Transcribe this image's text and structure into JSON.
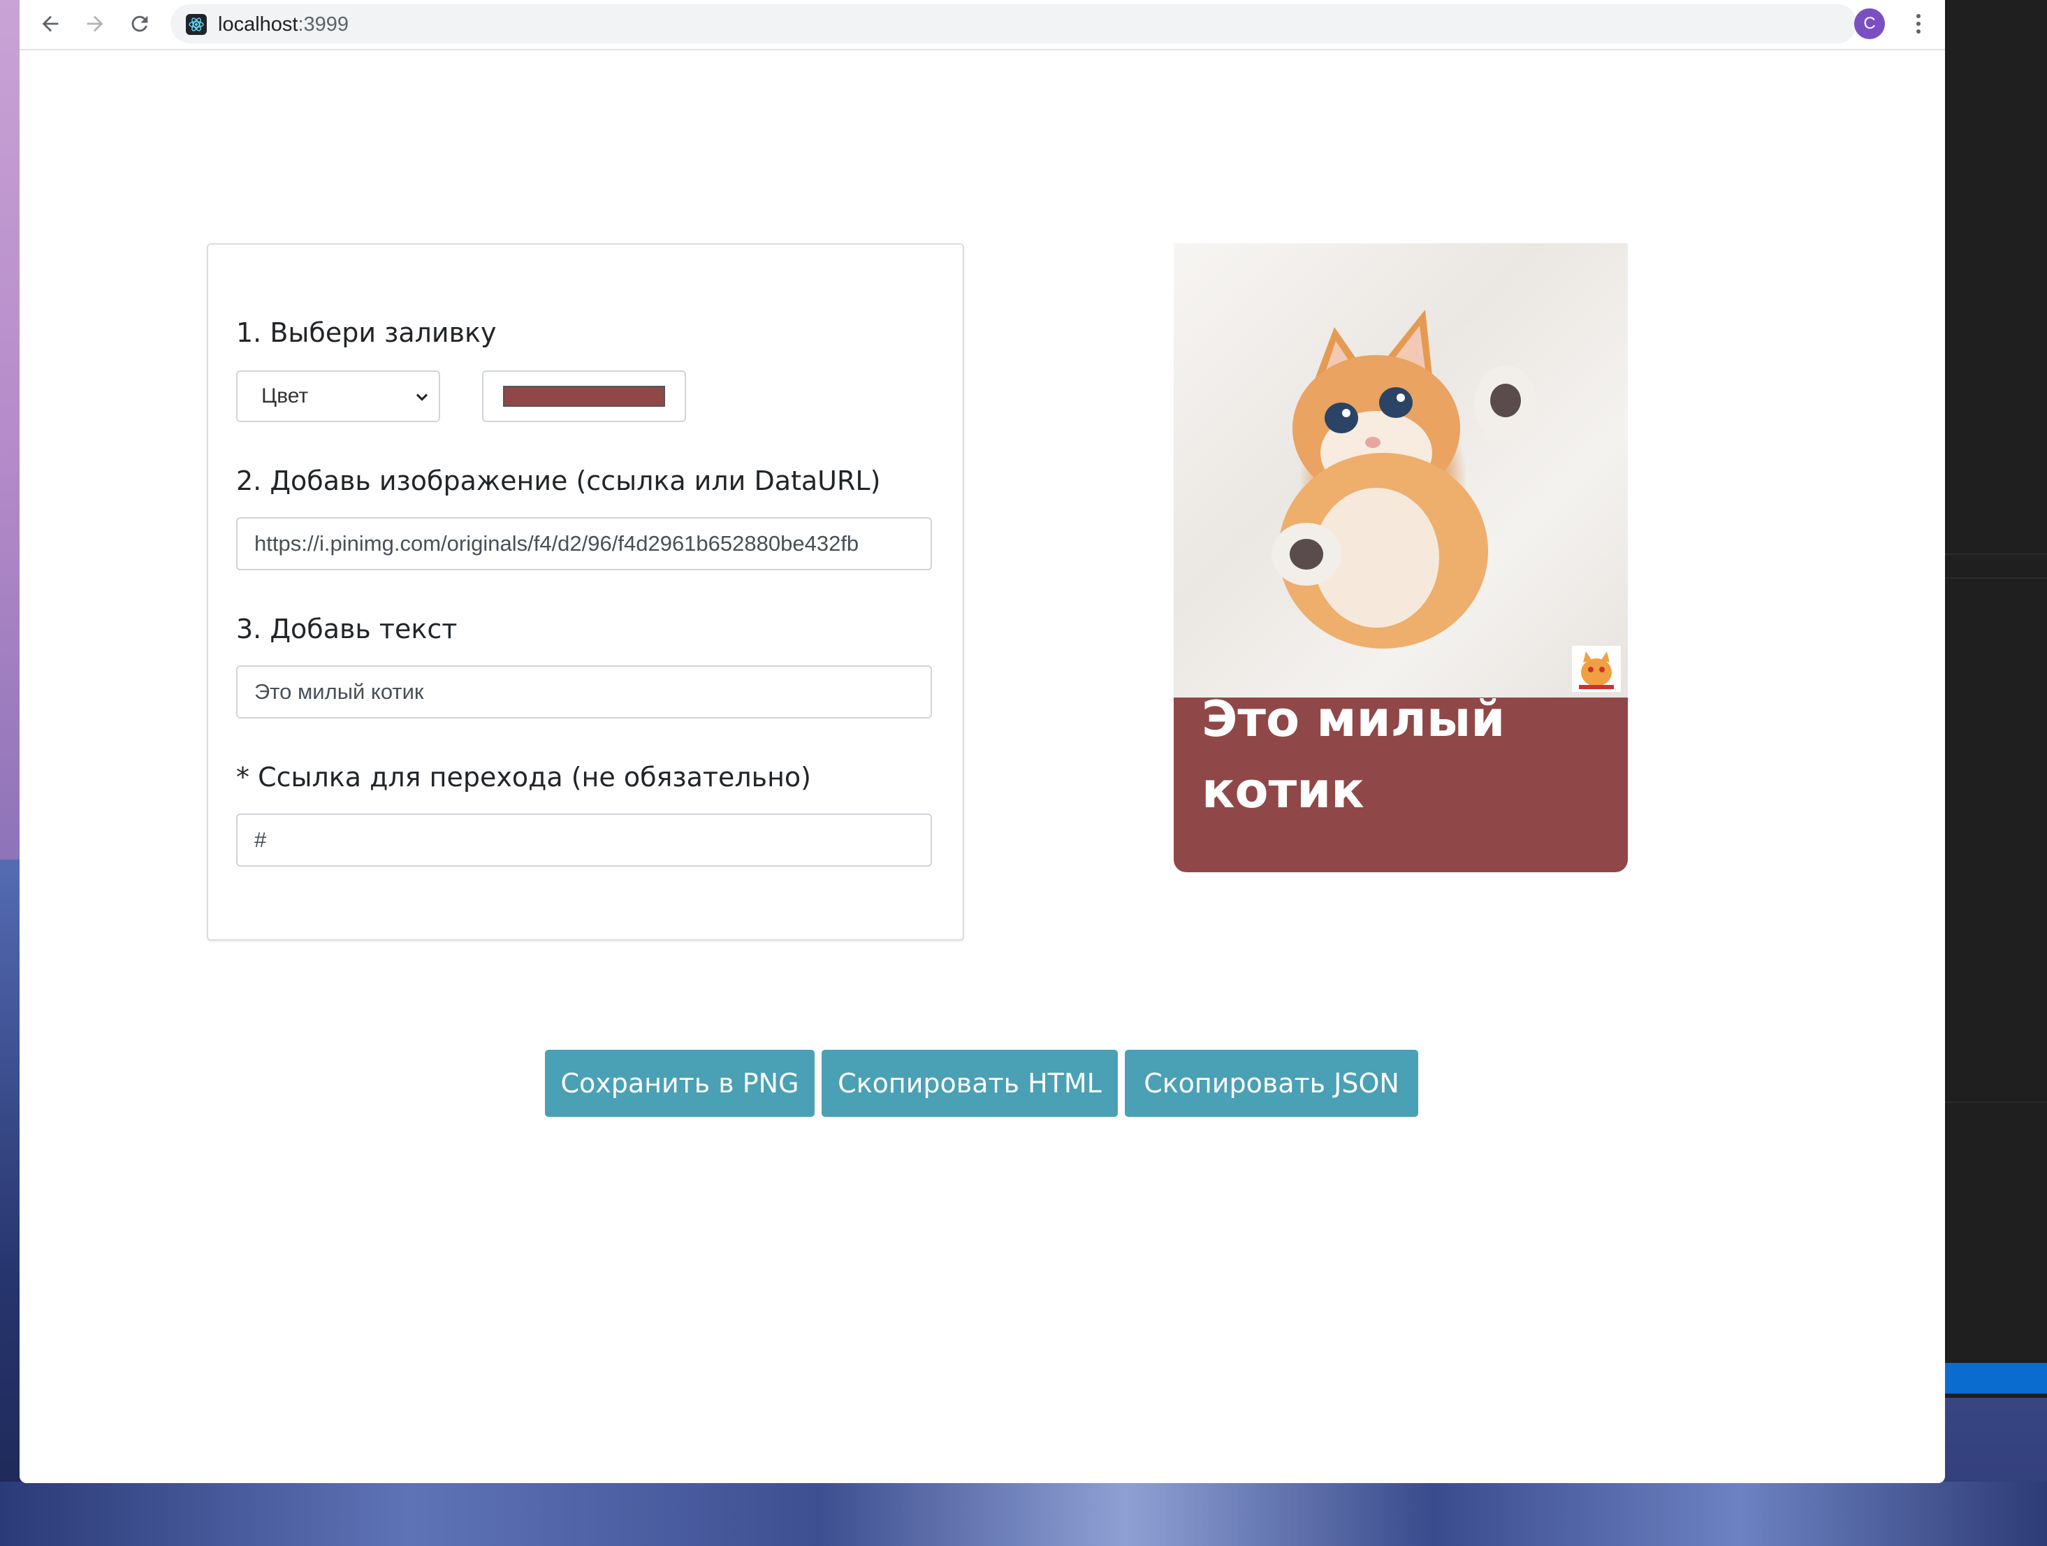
{
  "browser": {
    "url_host": "localhost",
    "url_port": ":3999",
    "profile_initial": "C",
    "icons": [
      "back-arrow-icon",
      "forward-arrow-icon",
      "reload-icon",
      "react-logo-icon",
      "kebab-menu-icon"
    ]
  },
  "form": {
    "step1": {
      "label": "1. Выбери заливку",
      "fill_type": "Цвет",
      "fill_color": "#8f4847"
    },
    "step2": {
      "label": "2. Добавь изображение (ссылка или DataURL)",
      "value": "https://i.pinimg.com/originals/f4/d2/96/f4d2961b652880be432fb"
    },
    "step3": {
      "label": "3. Добавь текст",
      "value": "Это милый котик"
    },
    "step4": {
      "label": "* Ссылка для перехода (не обязательно)",
      "value": "#"
    }
  },
  "preview": {
    "text": "Это милый котик",
    "background_color": "#8f4847",
    "image": "kitten-photo"
  },
  "actions": {
    "save_png": "Сохранить в PNG",
    "copy_html": "Скопировать HTML",
    "copy_json": "Скопировать JSON",
    "button_color": "#4aa0b5"
  }
}
